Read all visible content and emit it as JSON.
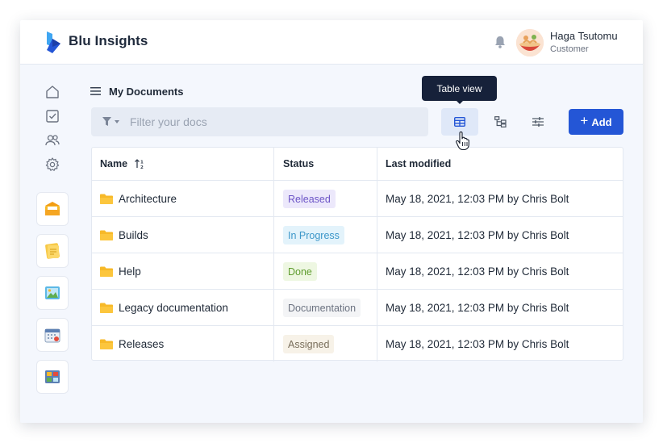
{
  "app": {
    "name": "Blu Insights"
  },
  "user": {
    "name": "Haga Tsutomu",
    "role": "Customer"
  },
  "nav": {
    "icons": [
      "home-icon",
      "checklist-icon",
      "users-icon",
      "settings-gear-icon"
    ]
  },
  "apps": [
    "envelope-app-icon",
    "notes-app-icon",
    "image-app-icon",
    "calendar-app-icon",
    "dashboard-app-icon"
  ],
  "page": {
    "title": "My Documents"
  },
  "filter": {
    "placeholder": "Filter your docs"
  },
  "toolbar": {
    "tooltip": "Table view",
    "add_label": "Add"
  },
  "table": {
    "columns": {
      "name": "Name",
      "status": "Status",
      "modified": "Last modified"
    },
    "rows": [
      {
        "name": "Architecture",
        "status": "Released",
        "modified": "May 18, 2021, 12:03 PM by Chris Bolt"
      },
      {
        "name": "Builds",
        "status": "In Progress",
        "modified": "May 18, 2021, 12:03 PM by Chris Bolt"
      },
      {
        "name": "Help",
        "status": "Done",
        "modified": "May 18, 2021, 12:03 PM by Chris Bolt"
      },
      {
        "name": "Legacy documentation",
        "status": "Documentation",
        "modified": "May 18, 2021, 12:03 PM by Chris Bolt"
      },
      {
        "name": "Releases",
        "status": "Assigned",
        "modified": "May 18, 2021, 12:03 PM by Chris Bolt"
      }
    ]
  },
  "colors": {
    "accent": "#2456d6",
    "folder": "#f7b928",
    "status_released": {
      "bg": "#ece8fb",
      "fg": "#6d55c7"
    },
    "status_in_progress": {
      "bg": "#e3f3fb",
      "fg": "#3c97c9"
    },
    "status_done": {
      "bg": "#eef7e2",
      "fg": "#5e9c2e"
    },
    "status_documentation": {
      "bg": "#f3f4f6",
      "fg": "#6b7280"
    },
    "status_assigned": {
      "bg": "#f7f2e8",
      "fg": "#7a6f5c"
    }
  }
}
